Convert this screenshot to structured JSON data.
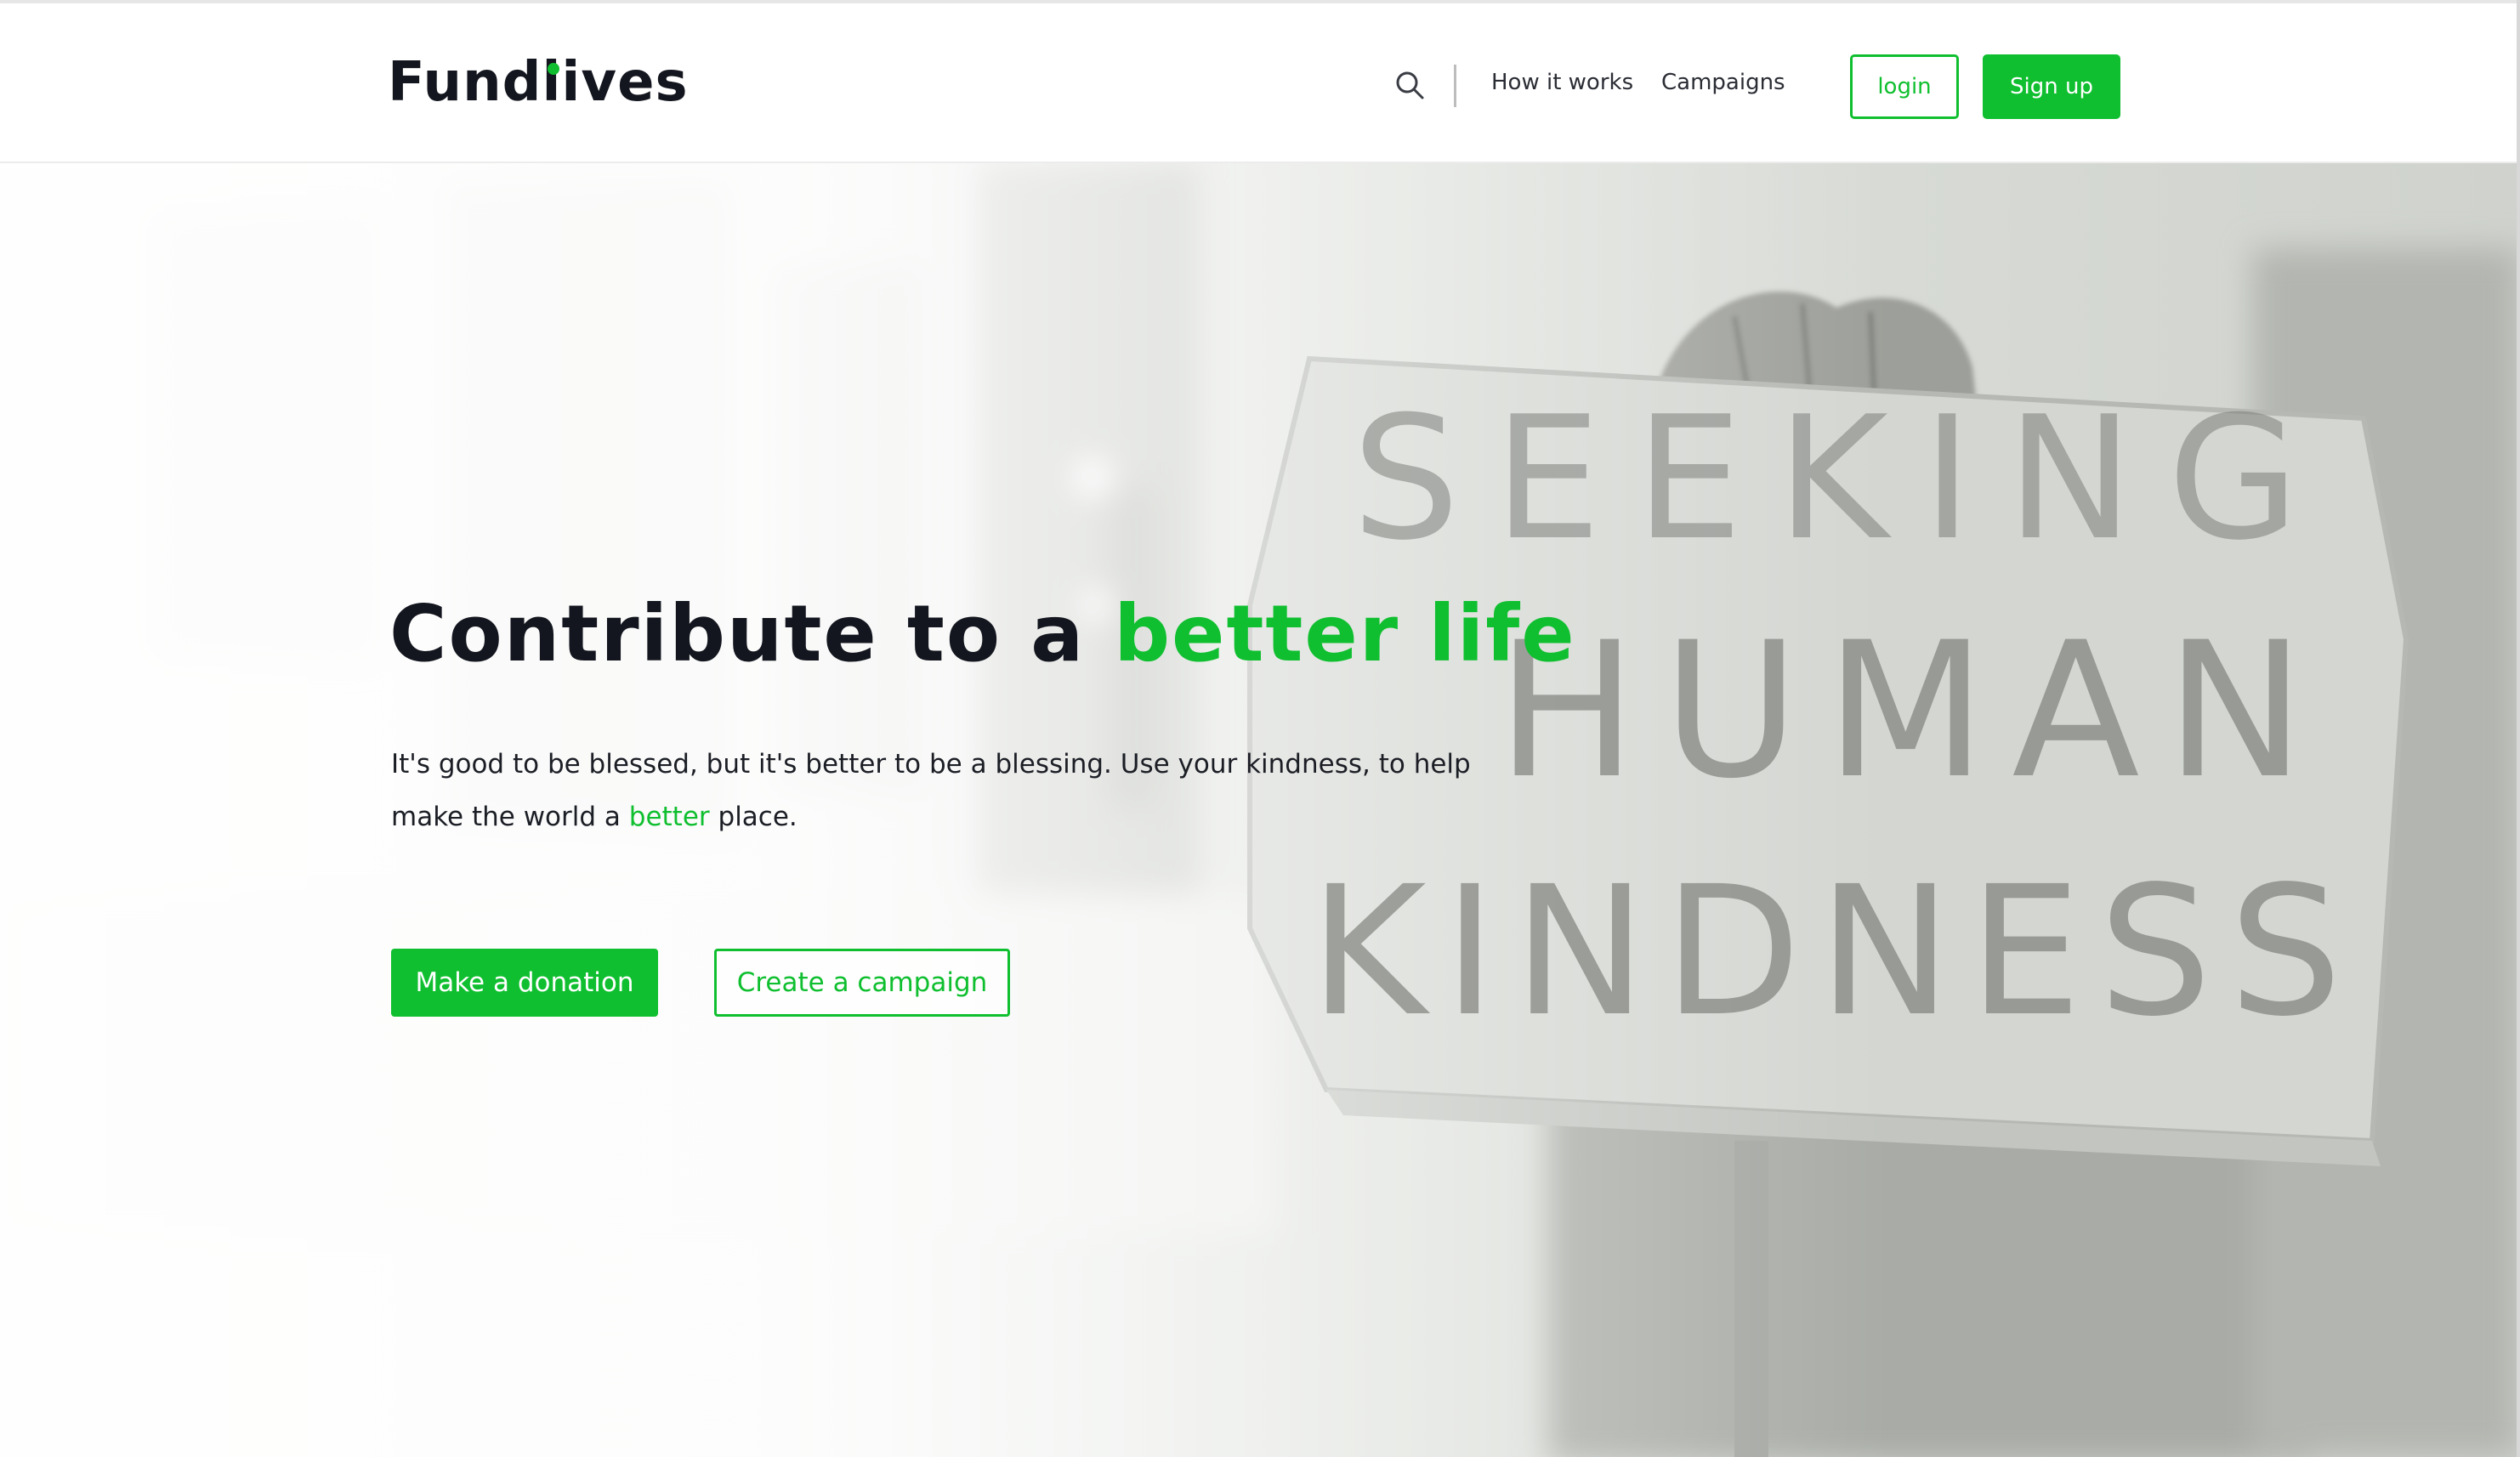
{
  "header": {
    "logo": "Fundlives",
    "nav": {
      "how_it_works": "How it works",
      "campaigns": "Campaigns"
    },
    "login_label": "login",
    "signup_label": "Sign up",
    "search_icon": "search-icon"
  },
  "hero": {
    "title_main": "Contribute to a ",
    "title_accent": "better life",
    "desc_part1": "It's good to be blessed, but it's better to be a blessing. Use your kindness, to help make the world a ",
    "desc_accent": "better",
    "desc_part2": " place.",
    "primary_button": "Make a donation",
    "secondary_button": "Create a campaign",
    "sign_lines": [
      "SEEKING",
      "HUMAN",
      "KINDNESS"
    ]
  },
  "colors": {
    "accent": "#0fbf2f",
    "text": "#14161f"
  }
}
